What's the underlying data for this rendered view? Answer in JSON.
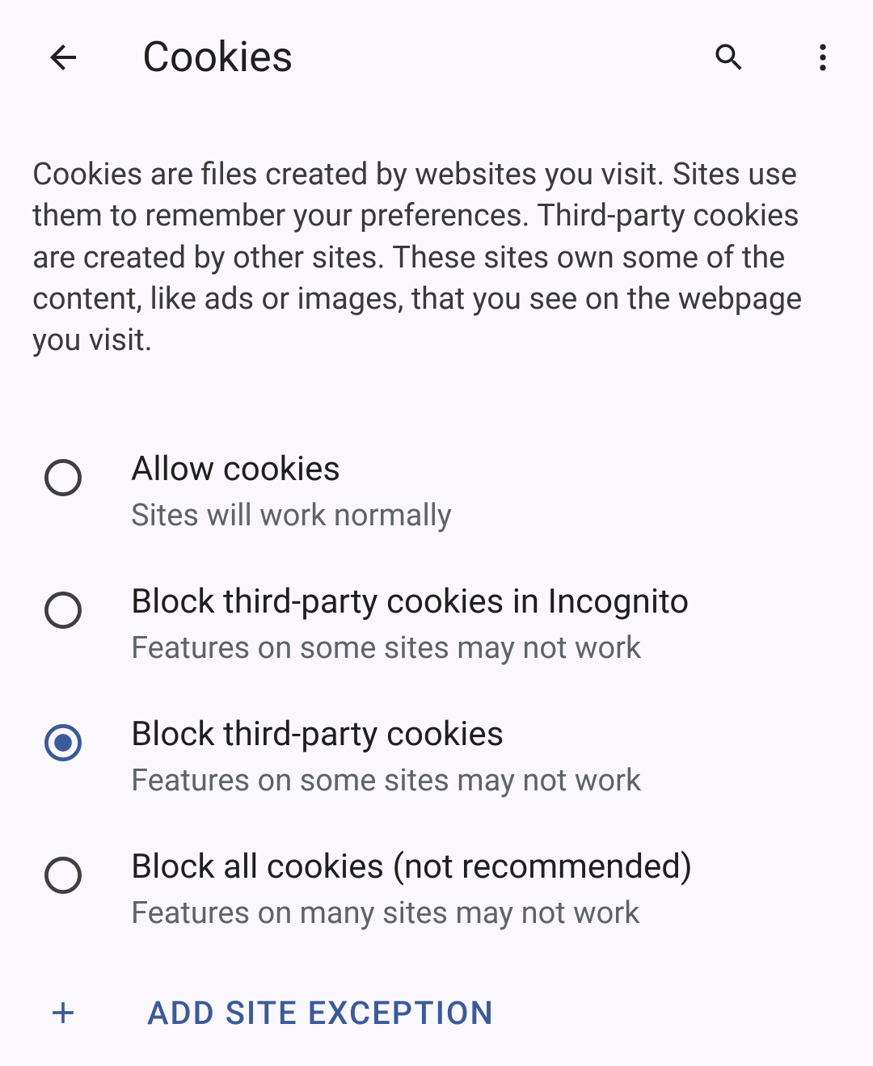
{
  "header": {
    "title": "Cookies"
  },
  "description": "Cookies are files created by websites you visit. Sites use them to remember your preferences. Third-party cookies are created by other sites. These sites own some of the content, like ads or images, that you see on the webpage you visit.",
  "options": [
    {
      "title": "Allow cookies",
      "subtitle": "Sites will work normally",
      "selected": false
    },
    {
      "title": "Block third-party cookies in Incognito",
      "subtitle": "Features on some sites may not work",
      "selected": false
    },
    {
      "title": "Block third-party cookies",
      "subtitle": "Features on some sites may not work",
      "selected": true
    },
    {
      "title": "Block all cookies (not recommended)",
      "subtitle": "Features on many sites may not work",
      "selected": false
    }
  ],
  "add_exception_label": "ADD SITE EXCEPTION",
  "colors": {
    "accent": "#3c5a99",
    "radio_unselected": "#3f3f3f",
    "radio_selected": "#3c5a99"
  }
}
